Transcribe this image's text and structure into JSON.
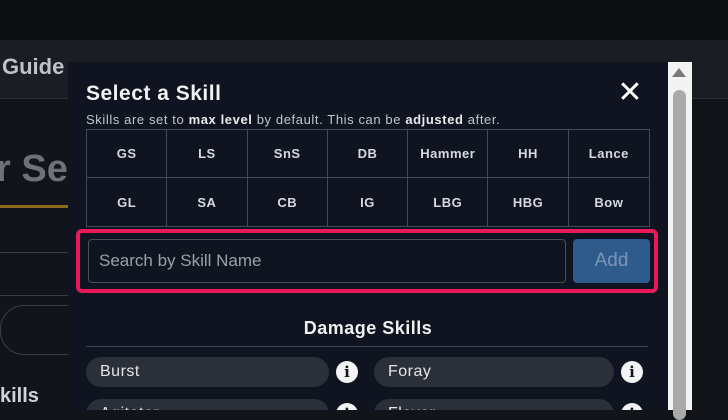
{
  "background": {
    "nav_text": "Guide",
    "heading_fragment": "r Set",
    "section_fragment": "kills"
  },
  "modal": {
    "title": "Select a Skill",
    "close_label": "✕",
    "note": {
      "part1": "Skills are set to ",
      "bold1": "max level",
      "part2": " by default. This can be ",
      "bold2": "adjusted",
      "part3": " after."
    },
    "weapons": [
      "GS",
      "LS",
      "SnS",
      "DB",
      "Hammer",
      "HH",
      "Lance",
      "GL",
      "SA",
      "CB",
      "IG",
      "LBG",
      "HBG",
      "Bow"
    ],
    "search": {
      "placeholder": "Search by Skill Name",
      "value": ""
    },
    "add_label": "Add",
    "section_title": "Damage Skills",
    "skills": [
      {
        "label": "Burst",
        "icon": "info-icon"
      },
      {
        "label": "Foray",
        "icon": "info-icon"
      },
      {
        "label": "Agitator",
        "icon": "info-icon"
      },
      {
        "label": "Flayer",
        "icon": "info-icon"
      }
    ]
  },
  "colors": {
    "modal_bg": "#0f1420",
    "highlight": "#e8195b",
    "add_button": "#2f5b8c",
    "pill_bg": "#2a2f38"
  }
}
